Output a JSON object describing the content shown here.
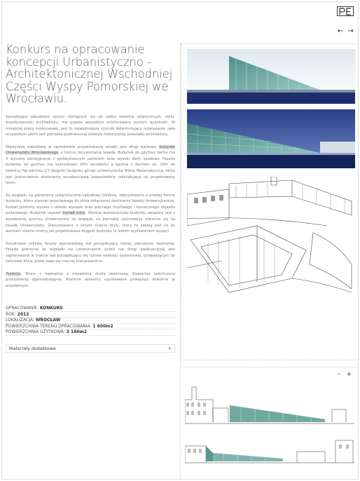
{
  "nav": {
    "prev_symbol": "←",
    "next_symbol": "→"
  },
  "logo": {
    "icon": "pe-logo-icon"
  },
  "article": {
    "title": "Konkurs na opracowanie koncepcji Urbanistyczno - Architektonicznej Wschodniej Części Wyspy Pomorskiej we Wrocławiu.",
    "p1": "Sąsiadujące zabudowie oprócz różniących się od siebie walorów estetycznych, stylu, współczesności architektury, ma przede wszystkim zróżnicowany poziom wysokości. W niniejszej pracy konkursowej, jest to najważniejszy czynnik determinujący rozwiązanie, jako oczywistym jakim jest potrzeba podniesionej estetyki historycznej powstałej architektury.",
    "p2_a": "Najwyższą zabudową w sąsiedztwie projektowanej działki jest długi barkowy",
    "p2_hl": "budynek Uniwersytetu Wrocławskiego",
    "p2_b": "z mocno horyzontalną fasadą. Budynek do gzymsu dachu ma 3 wysokie kondygnacje z podwyższonym parterem oraz wysoki dach spadowy. Fasada budynku do gzymsu ma szacunkowo 20m wysokości a łącznie z dachem ok. 29m do kalenicy. Na odcinku 1/3 długości budynku góruje uniwersytecka Wieża Matematyczna, która jest jednocześnie dominantą wysokościową bezpośrednio oddziałującą na projektowany teren.",
    "p3_a": "Ze względu na parametry urbanistyczne zabudowy lokalnej, zdecydowano o prostej formie budynku, która stanowi przeciwwagę do silnie dołączonej dominanty fasady Uniwersyteckiej. Kształt poziomy wynika z układu wysepki oraz jedynego możliwego i koniecznego dojazdu pożarowego. Budynek uzyskał",
    "p3_hl": "kształt kliny",
    "p3_b": ". Wyższe wysokościowy budynku związany jest z wysokością gzymsu Uniwersytetu ze względu na potrzebę zachowania otwarcia się na fasadę Uniwersytetu. Zdecydowano o silnym ścięciu bryły, który to zabieg jest co do wartości równie istotny jak projektowana długość budynku (z lekkim wydłużeniem wyspy).",
    "p4": "Południowe szkliwa fasady wprowadzają ład porządkujący różnej zabudowie okolicznej. Fasada północna ze względu na umieszczenie przed nią drogi ewakuacyjnej jest zaplanowana w trakcie ład porządkujący się rytmie elewacji systemowej, prowadzącym do końcówki klina, gdzie staje się mocnej transparentna.",
    "p5_hl": "Funkcja",
    "p5_b": ": Biura + kawiarnia z niezależną strefą wejściową. Kawiarnia zakończona przeszklenią ogólnodostępną. Roślinne wiewiory uzyskowane powiązują dowolnie je przydatnych."
  },
  "meta": {
    "label_opracowanie": "OPRACOWANIE:",
    "value_opracowanie": "KONKURS",
    "label_rok": "ROK:",
    "value_rok": "2012",
    "label_lokalizacja": "LOKALIZACJA:",
    "value_lokalizacja": "WROCŁAW",
    "label_powierzchnia_terenu": "POWIERZCHNIA TERENU OPRACOWANIA:",
    "value_powierzchnia_terenu": "1 600m2",
    "label_powierzchnia_uzytkowa": "POWIERZCHNIA UŻYTKOWA:",
    "value_powierzchnia_uzytkowa": "3 160m2"
  },
  "more": {
    "label": "Materiały dodatkowe",
    "toggle": "+"
  },
  "gallery": {
    "zoom_out": "–",
    "zoom_in": "+"
  },
  "colors": {
    "glass": "#6fa9a2",
    "sky": "#1b2a6b",
    "accent_line": "#e0e0e0"
  }
}
